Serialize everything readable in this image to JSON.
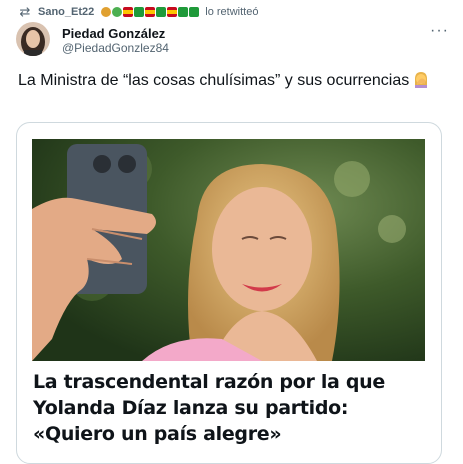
{
  "retweet": {
    "user": "Sano_Et22",
    "action_text": "lo retwitteó",
    "icon": "retweet-icon"
  },
  "author": {
    "name": "Piedad González",
    "handle": "@PiedadGonzlez84",
    "avatar_icon": "avatar"
  },
  "tweet": {
    "text": "La Ministra de “las cosas chulísimas” y sus ocurrencias",
    "emoji": "woman-facepalming"
  },
  "card": {
    "headline": "La trascendental razón por la que Yolanda Díaz lanza su partido: «Quiero un país alegre»"
  },
  "colors": {
    "text_primary": "#0f1419",
    "text_secondary": "#536471",
    "border": "#cfd9de"
  }
}
